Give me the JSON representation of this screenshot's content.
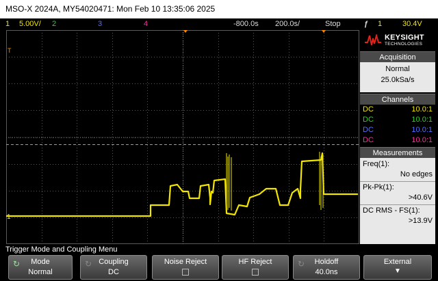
{
  "title": "MSO-X 2024A, MY54020471: Mon Feb 10 13:35:06 2025",
  "status": {
    "ch1_num": "1",
    "ch1_scale": "5.00V/",
    "ch2_num": "2",
    "ch3_num": "3",
    "ch4_num": "4",
    "time_offset": "-800.0s",
    "time_scale": "200.0s/",
    "run_state": "Stop",
    "trig_icon": "ƒ",
    "trig_source": "1",
    "trig_level": "30.4V"
  },
  "markers": {
    "channel1": "1",
    "trigger": "T"
  },
  "logo": {
    "brand": "KEYSIGHT",
    "sub": "TECHNOLOGIES"
  },
  "acquisition": {
    "header": "Acquisition",
    "mode": "Normal",
    "rate": "25.0kSa/s"
  },
  "channels": {
    "header": "Channels",
    "items": [
      {
        "coupling": "DC",
        "probe": "10.0:1",
        "color": "#f2e600"
      },
      {
        "coupling": "DC",
        "probe": "10.0:1",
        "color": "#2bd42b"
      },
      {
        "coupling": "DC",
        "probe": "10.0:1",
        "color": "#5a6cff"
      },
      {
        "coupling": "DC",
        "probe": "10.0:1",
        "color": "#ff2d9b"
      }
    ]
  },
  "measurements": {
    "header": "Measurements",
    "freq_label": "Freq(1):",
    "freq_value": "No edges",
    "pkpk_label": "Pk-Pk(1):",
    "pkpk_value": ">40.6V",
    "dcrms_label": "DC RMS - FS(1):",
    "dcrms_value": ">13.9V"
  },
  "menu_label": "Trigger Mode and Coupling Menu",
  "softkeys": {
    "mode_label": "Mode",
    "mode_value": "Normal",
    "coupling_label": "Coupling",
    "coupling_value": "DC",
    "noise_label": "Noise Reject",
    "hf_label": "HF Reject",
    "holdoff_label": "Holdoff",
    "holdoff_value": "40.0ns",
    "external_label": "External"
  },
  "colors": {
    "trace": "#f2e600",
    "trigger_line": "#ff8a00",
    "grid": "#5a5a5a"
  },
  "icons": {
    "mode": "refresh-icon",
    "coupling": "refresh-icon",
    "holdoff": "refresh-icon",
    "external": "arrow-down-icon",
    "trigger": "trigger-edge-icon"
  }
}
